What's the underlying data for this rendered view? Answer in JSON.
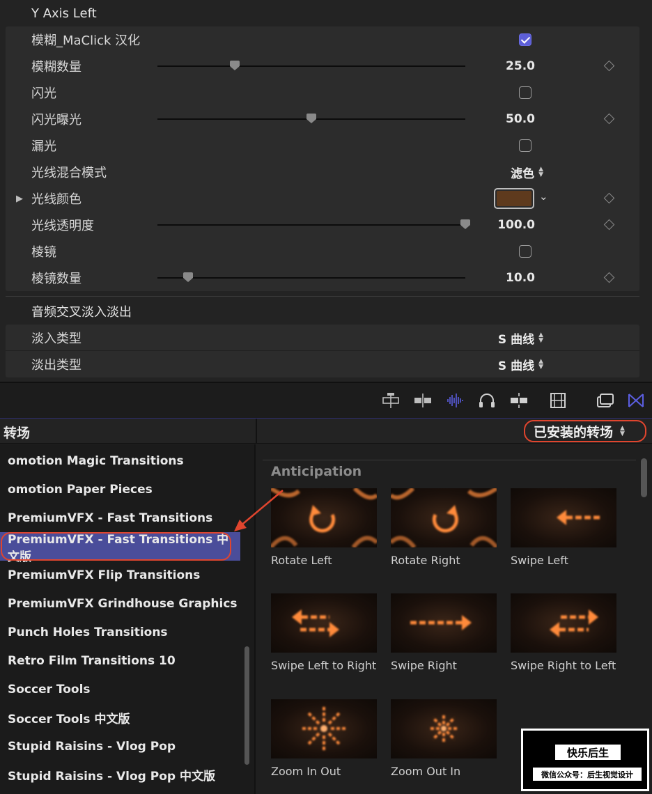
{
  "inspector": {
    "section1_title": "Y Axis Left",
    "params": [
      {
        "label": "模糊_MaClick 汉化",
        "kind": "checkbox",
        "checked": true
      },
      {
        "label": "模糊数量",
        "kind": "slider",
        "value": "25.0",
        "fraction": 0.25
      },
      {
        "label": "闪光",
        "kind": "checkbox",
        "checked": false
      },
      {
        "label": "闪光曝光",
        "kind": "slider",
        "value": "50.0",
        "fraction": 0.5
      },
      {
        "label": "漏光",
        "kind": "checkbox",
        "checked": false
      },
      {
        "label": "光线混合模式",
        "kind": "popup",
        "value": "滤色"
      },
      {
        "label": "光线颜色",
        "kind": "color",
        "color": "#5e3a1d"
      },
      {
        "label": "光线透明度",
        "kind": "slider",
        "value": "100.0",
        "fraction": 1.0
      },
      {
        "label": "棱镜",
        "kind": "checkbox",
        "checked": false
      },
      {
        "label": "棱镜数量",
        "kind": "slider",
        "value": "10.0",
        "fraction": 0.1
      }
    ],
    "section2_title": "音频交叉淡入淡出",
    "audio_params": [
      {
        "label": "淡入类型",
        "value": "S 曲线"
      },
      {
        "label": "淡出类型",
        "value": "S 曲线"
      }
    ]
  },
  "toolbar": {
    "icons": [
      "clip-appearance-icon",
      "snapping-icon",
      "audio-waveform-icon",
      "headphones-icon",
      "skimming-icon",
      "filmstrip-icon",
      "window-layout-icon",
      "transitions-icon"
    ],
    "accent": "#5b5ee0"
  },
  "browser": {
    "panel_title": "转场",
    "installed_label": "已安装的转场",
    "sidebar_items": [
      "omotion Magic Transitions",
      "omotion Paper Pieces",
      "PremiumVFX - Fast Transitions",
      "PremiumVFX - Fast Transitions 中文版",
      "PremiumVFX Flip Transitions",
      "PremiumVFX Grindhouse Graphics",
      "Punch Holes Transitions",
      "Retro Film Transitions 10",
      "Soccer Tools",
      "Soccer Tools 中文版",
      "Stupid Raisins - Vlog Pop",
      "Stupid Raisins - Vlog Pop 中文版"
    ],
    "selected_index": 3,
    "category": "Anticipation",
    "tiles": [
      {
        "label": "Rotate Left",
        "icon": "rotate-left-icon"
      },
      {
        "label": "Rotate Right",
        "icon": "rotate-right-icon"
      },
      {
        "label": "Swipe Left",
        "icon": "swipe-left-icon"
      },
      {
        "label": "Swipe Left to Right",
        "icon": "swipe-left-to-right-icon"
      },
      {
        "label": "Swipe Right",
        "icon": "swipe-right-icon"
      },
      {
        "label": "Swipe Right to Left",
        "icon": "swipe-right-to-left-icon"
      },
      {
        "label": "Zoom In Out",
        "icon": "zoom-in-out-icon"
      },
      {
        "label": "Zoom Out In",
        "icon": "zoom-out-in-icon"
      }
    ],
    "highlight_color": "#e0452e",
    "selection_color": "#4a4d9a",
    "tile_glow_color": "#ff8a3a"
  },
  "watermark": {
    "title": "快乐后生",
    "subtitle": "微信公众号：后生视觉设计"
  }
}
